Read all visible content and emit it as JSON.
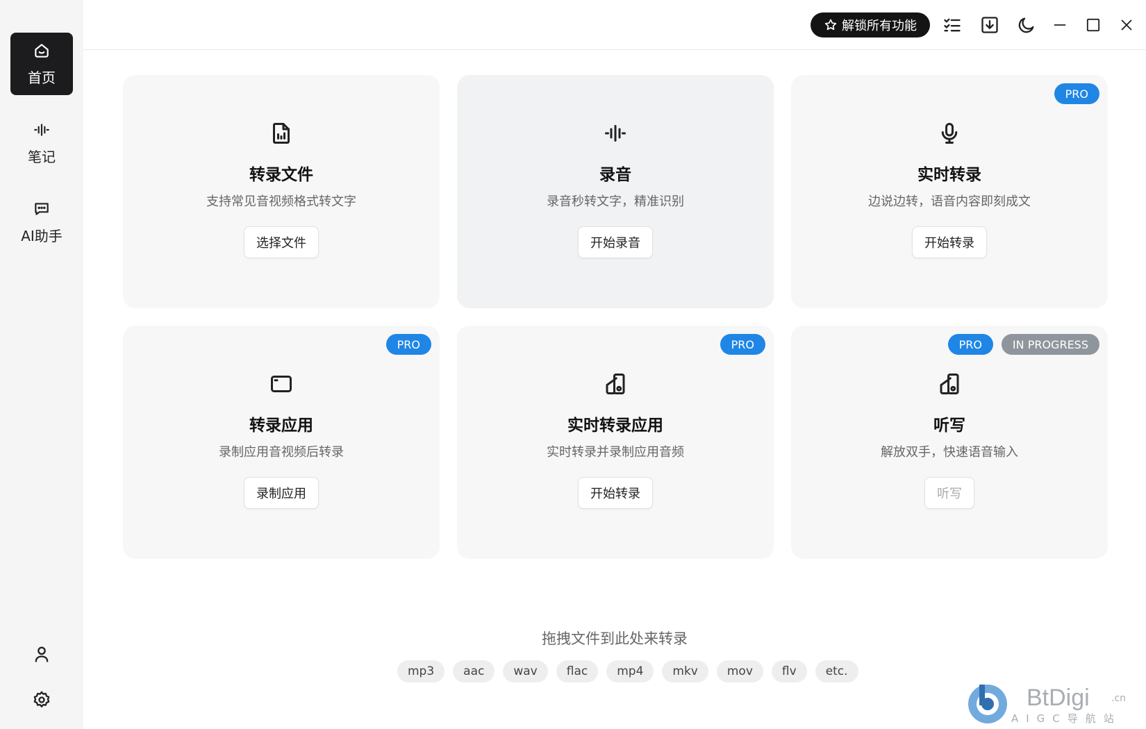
{
  "sidebar": {
    "items": [
      {
        "label": "首页",
        "icon": "home-icon",
        "active": true
      },
      {
        "label": "笔记",
        "icon": "waveform-icon",
        "active": false
      },
      {
        "label": "AI助手",
        "icon": "chat-bubble-icon",
        "active": false
      }
    ],
    "bottom_icons": [
      "user-icon",
      "gear-icon"
    ]
  },
  "topbar": {
    "unlock_label": "解锁所有功能",
    "icons": [
      "task-list-icon",
      "download-icon",
      "moon-icon",
      "minimize-icon",
      "maximize-icon",
      "close-icon"
    ]
  },
  "cards": [
    {
      "title": "转录文件",
      "desc": "支持常见音视频格式转文字",
      "button": "选择文件",
      "icon": "audio-file-icon",
      "badges": []
    },
    {
      "title": "录音",
      "desc": "录音秒转文字，精准识别",
      "button": "开始录音",
      "icon": "waveform-icon",
      "badges": []
    },
    {
      "title": "实时转录",
      "desc": "边说边转，语音内容即刻成文",
      "button": "开始转录",
      "icon": "microphone-icon",
      "badges": [
        "PRO"
      ]
    },
    {
      "title": "转录应用",
      "desc": "录制应用音视频后转录",
      "button": "录制应用",
      "icon": "app-window-icon",
      "badges": [
        "PRO"
      ]
    },
    {
      "title": "实时转录应用",
      "desc": "实时转录并录制应用音频",
      "button": "开始转录",
      "icon": "shapes-icon",
      "badges": [
        "PRO"
      ]
    },
    {
      "title": "听写",
      "desc": "解放双手，快速语音输入",
      "button": "听写",
      "icon": "shapes-icon",
      "badges": [
        "PRO",
        "IN PROGRESS"
      ],
      "button_disabled": true
    }
  ],
  "drop": {
    "text": "拖拽文件到此处来转录",
    "formats": [
      "mp3",
      "aac",
      "wav",
      "flac",
      "mp4",
      "mkv",
      "mov",
      "flv",
      "etc."
    ]
  },
  "watermark": {
    "brand": "BtDigi",
    "suffix": ".cn",
    "subtitle": "AIGC导航站"
  },
  "colors": {
    "accent": "#1f86e5",
    "dark": "#1c1c1e",
    "progress_badge": "#8f959c"
  }
}
